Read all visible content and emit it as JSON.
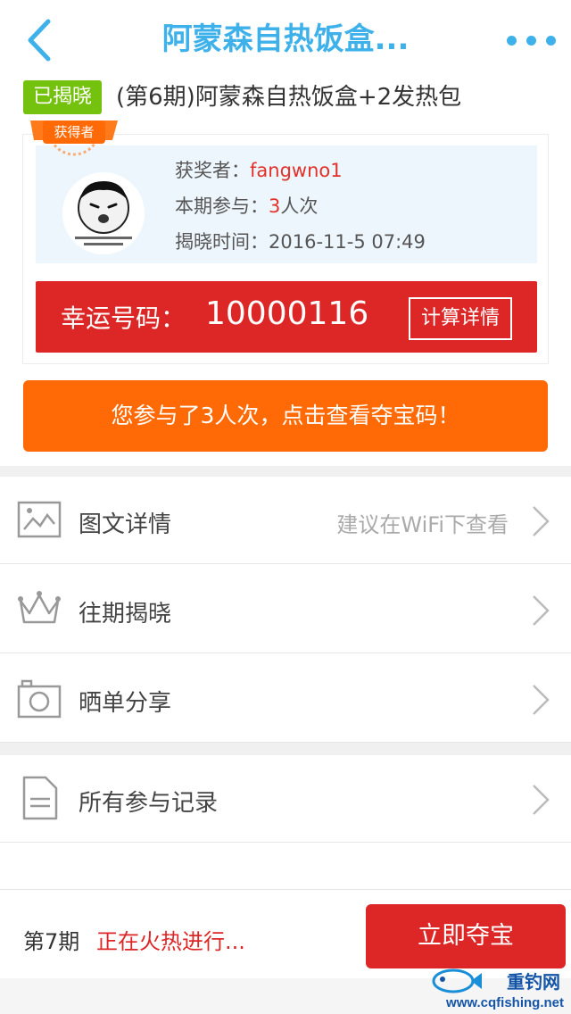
{
  "header": {
    "title": "阿蒙森自热饭盒...",
    "back_icon": "chevron-left-icon",
    "more_icon": "more-dots-icon",
    "accent_color": "#3fb1ea"
  },
  "product": {
    "status_badge": "已揭晓",
    "title": "(第6期)阿蒙森自热饭盒+2发热包"
  },
  "winner": {
    "ribbon_label": "获得者",
    "winner_label": "获奖者：",
    "winner_name": "fangwno1",
    "participation_label": "本期参与：",
    "participation_count": "3",
    "participation_unit": "人次",
    "reveal_time_label": "揭晓时间：",
    "reveal_time": "2016-11-5 07:49",
    "avatar_icon": "meme-face-avatar"
  },
  "lucky": {
    "label": "幸运号码：",
    "number": "10000116",
    "calc_button": "计算详情"
  },
  "cta": {
    "label": "您参与了3人次，点击查看夺宝码！",
    "color": "#ff6a06"
  },
  "menu": {
    "details": {
      "label": "图文详情",
      "hint": "建议在WiFi下查看",
      "icon": "image-icon"
    },
    "past": {
      "label": "往期揭晓",
      "icon": "crown-icon"
    },
    "share": {
      "label": "晒单分享",
      "icon": "camera-icon"
    },
    "records": {
      "label": "所有参与记录",
      "icon": "document-icon"
    }
  },
  "footer": {
    "period_label": "第7期",
    "period_status": "正在火热进行...",
    "buy_button": "立即夺宝",
    "buy_color": "#dd2727"
  },
  "watermark": {
    "brand": "重钓网",
    "url": "www.cqfishing.net"
  }
}
